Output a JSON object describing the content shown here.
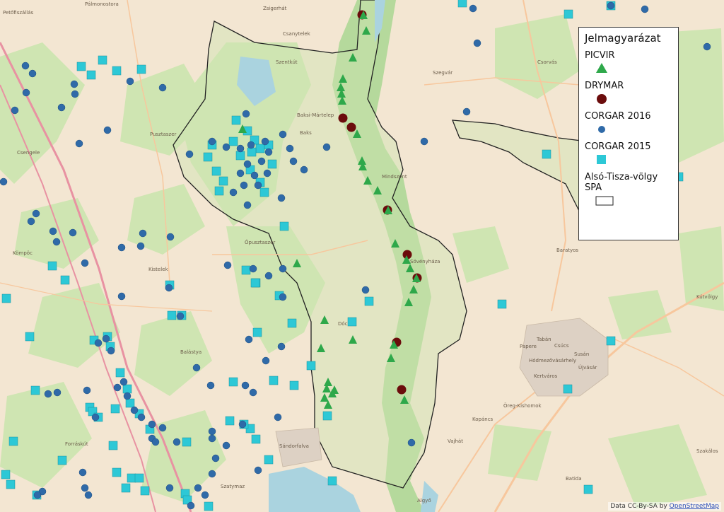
{
  "colors": {
    "background": "#f3e6d2",
    "green_area": "#cfe5b2",
    "dark_green": "#b5d99c",
    "water": "#aad3df",
    "road_major": "#e892a2",
    "road_minor": "#f7c79d",
    "picvir": "#2ea84a",
    "drymar": "#6b0c0c",
    "corgar2016": "#2f6aa8",
    "corgar2015": "#2dc8d6",
    "spa_outline": "#222222"
  },
  "legend": {
    "title": "Jelmagyarázat",
    "items": [
      {
        "label": "PICVIR",
        "symbol": "green-triangle"
      },
      {
        "label": "DRYMAR",
        "symbol": "dark-red-circle"
      },
      {
        "label": "CORGAR 2016",
        "symbol": "blue-circle"
      },
      {
        "label": "CORGAR 2015",
        "symbol": "cyan-square"
      },
      {
        "label": "Alsó-Tisza-völgy SPA",
        "symbol": "outline-rectangle"
      }
    ]
  },
  "place_labels": [
    "Mindszent",
    "Kistelek",
    "Hódmezővásárhely",
    "Sándorfalva",
    "Baksi-Mártelep",
    "Szegvár",
    "Balástya",
    "Ópusztaszer",
    "Baratyos",
    "Csorvás",
    "Kútvölgy",
    "Öreg-Kishomok",
    "Újvásár",
    "Tabán",
    "Susán",
    "Csúcs",
    "Papere",
    "Kertváros",
    "Kopáncs",
    "Szakálos",
    "Batida",
    "Vajhát",
    "Kömpöc",
    "Forráskút",
    "Csengele",
    "Pusztaszer",
    "Dóc",
    "Sövényháza",
    "Zsigerhát",
    "Csanytelek",
    "Szentkút",
    "Pálmonostora",
    "Petőfiszállás",
    "Baks",
    "Algyő",
    "Szatymaz"
  ],
  "attribution": {
    "text": "Data CC-By-SA by ",
    "link": "OpenStreetMap"
  },
  "layers": {
    "picvir": [
      [
        514,
        22
      ],
      [
        518,
        44
      ],
      [
        499,
        82
      ],
      [
        485,
        112
      ],
      [
        482,
        124
      ],
      [
        483,
        133
      ],
      [
        484,
        143
      ],
      [
        512,
        228
      ],
      [
        513,
        236
      ],
      [
        520,
        256
      ],
      [
        534,
        270
      ],
      [
        549,
        298
      ],
      [
        559,
        345
      ],
      [
        575,
        368
      ],
      [
        580,
        380
      ],
      [
        589,
        394
      ],
      [
        585,
        410
      ],
      [
        578,
        428
      ],
      [
        420,
        373
      ],
      [
        459,
        453
      ],
      [
        454,
        493
      ],
      [
        499,
        481
      ],
      [
        557,
        488
      ],
      [
        553,
        507
      ],
      [
        464,
        541
      ],
      [
        462,
        550
      ],
      [
        470,
        557
      ],
      [
        473,
        552
      ],
      [
        459,
        563
      ],
      [
        464,
        573
      ],
      [
        572,
        566
      ],
      [
        505,
        190
      ],
      [
        343,
        183
      ]
    ],
    "drymar": [
      [
        512,
        21
      ],
      [
        485,
        167
      ],
      [
        497,
        180
      ],
      [
        548,
        297
      ],
      [
        576,
        360
      ],
      [
        590,
        393
      ],
      [
        561,
        484
      ],
      [
        568,
        551
      ]
    ],
    "corgar2016": [
      [
        675,
        61
      ],
      [
        1000,
        66
      ],
      [
        864,
        8
      ],
      [
        912,
        13
      ],
      [
        669,
        12
      ],
      [
        36,
        93
      ],
      [
        46,
        104
      ],
      [
        37,
        131
      ],
      [
        21,
        156
      ],
      [
        87,
        152
      ],
      [
        105,
        119
      ],
      [
        106,
        133
      ],
      [
        184,
        115
      ],
      [
        230,
        124
      ],
      [
        348,
        161
      ],
      [
        152,
        184
      ],
      [
        112,
        203
      ],
      [
        268,
        218
      ],
      [
        300,
        200
      ],
      [
        320,
        208
      ],
      [
        340,
        210
      ],
      [
        355,
        205
      ],
      [
        375,
        200
      ],
      [
        380,
        215
      ],
      [
        370,
        228
      ],
      [
        350,
        232
      ],
      [
        340,
        245
      ],
      [
        360,
        248
      ],
      [
        378,
        245
      ],
      [
        365,
        262
      ],
      [
        345,
        262
      ],
      [
        330,
        272
      ],
      [
        350,
        290
      ],
      [
        398,
        280
      ],
      [
        415,
        228
      ],
      [
        462,
        208
      ],
      [
        400,
        190
      ],
      [
        410,
        210
      ],
      [
        430,
        240
      ],
      [
        5,
        257
      ],
      [
        51,
        302
      ],
      [
        44,
        313
      ],
      [
        75,
        327
      ],
      [
        103,
        329
      ],
      [
        202,
        330
      ],
      [
        241,
        335
      ],
      [
        199,
        348
      ],
      [
        80,
        342
      ],
      [
        120,
        372
      ],
      [
        172,
        350
      ],
      [
        239,
        407
      ],
      [
        172,
        419
      ],
      [
        255,
        447
      ],
      [
        322,
        375
      ],
      [
        358,
        380
      ],
      [
        380,
        390
      ],
      [
        400,
        420
      ],
      [
        398,
        490
      ],
      [
        352,
        480
      ],
      [
        376,
        510
      ],
      [
        298,
        545
      ],
      [
        278,
        520
      ],
      [
        347,
        545
      ],
      [
        358,
        555
      ],
      [
        68,
        557
      ],
      [
        81,
        555
      ],
      [
        123,
        552
      ],
      [
        157,
        496
      ],
      [
        150,
        479
      ],
      [
        139,
        485
      ],
      [
        175,
        540
      ],
      [
        166,
        548
      ],
      [
        180,
        560
      ],
      [
        190,
        580
      ],
      [
        200,
        590
      ],
      [
        215,
        600
      ],
      [
        230,
        605
      ],
      [
        250,
        625
      ],
      [
        300,
        610
      ],
      [
        300,
        620
      ],
      [
        320,
        630
      ],
      [
        305,
        648
      ],
      [
        300,
        670
      ],
      [
        280,
        690
      ],
      [
        290,
        700
      ],
      [
        135,
        590
      ],
      [
        215,
        620
      ],
      [
        220,
        625
      ],
      [
        117,
        668
      ],
      [
        120,
        690
      ],
      [
        125,
        700
      ],
      [
        240,
        690
      ],
      [
        270,
        715
      ],
      [
        60,
        695
      ],
      [
        53,
        700
      ],
      [
        517,
        410
      ],
      [
        582,
        626
      ],
      [
        393,
        590
      ],
      [
        343,
        600
      ],
      [
        365,
        665
      ],
      [
        400,
        380
      ],
      [
        600,
        200
      ],
      [
        660,
        158
      ]
    ],
    "corgar2015": [
      [
        145,
        85
      ],
      [
        115,
        94
      ],
      [
        129,
        106
      ],
      [
        165,
        100
      ],
      [
        200,
        98
      ],
      [
        654,
        4
      ],
      [
        804,
        20
      ],
      [
        864,
        8
      ],
      [
        334,
        170
      ],
      [
        350,
        185
      ],
      [
        360,
        198
      ],
      [
        368,
        210
      ],
      [
        380,
        205
      ],
      [
        356,
        215
      ],
      [
        340,
        220
      ],
      [
        300,
        205
      ],
      [
        330,
        200
      ],
      [
        294,
        222
      ],
      [
        306,
        242
      ],
      [
        316,
        256
      ],
      [
        310,
        270
      ],
      [
        354,
        240
      ],
      [
        368,
        258
      ],
      [
        374,
        272
      ],
      [
        385,
        232
      ],
      [
        773,
        218
      ],
      [
        960,
        250
      ],
      [
        710,
        430
      ],
      [
        803,
        550
      ],
      [
        864,
        482
      ],
      [
        832,
        692
      ],
      [
        402,
        320
      ],
      [
        348,
        382
      ],
      [
        362,
        400
      ],
      [
        364,
        470
      ],
      [
        395,
        418
      ],
      [
        413,
        457
      ],
      [
        440,
        517
      ],
      [
        416,
        545
      ],
      [
        387,
        538
      ],
      [
        463,
        588
      ],
      [
        498,
        455
      ],
      [
        522,
        426
      ],
      [
        9,
        422
      ],
      [
        42,
        476
      ],
      [
        74,
        376
      ],
      [
        92,
        396
      ],
      [
        152,
        476
      ],
      [
        133,
        481
      ],
      [
        156,
        490
      ],
      [
        50,
        552
      ],
      [
        127,
        576
      ],
      [
        131,
        582
      ],
      [
        139,
        590
      ],
      [
        180,
        550
      ],
      [
        184,
        570
      ],
      [
        197,
        585
      ],
      [
        212,
        607
      ],
      [
        264,
        625
      ],
      [
        362,
        621
      ],
      [
        354,
        606
      ],
      [
        345,
        600
      ],
      [
        325,
        595
      ],
      [
        243,
        446
      ],
      [
        361,
        400
      ],
      [
        19,
        624
      ],
      [
        88,
        651
      ],
      [
        160,
        630
      ],
      [
        165,
        668
      ],
      [
        178,
        690
      ],
      [
        186,
        676
      ],
      [
        197,
        676
      ],
      [
        205,
        694
      ],
      [
        262,
        698
      ],
      [
        295,
        716
      ],
      [
        265,
        707
      ],
      [
        8,
        671
      ],
      [
        15,
        685
      ],
      [
        52,
        700
      ],
      [
        380,
        650
      ],
      [
        470,
        680
      ],
      [
        240,
        403
      ],
      [
        257,
        446
      ],
      [
        170,
        527
      ],
      [
        163,
        578
      ],
      [
        330,
        540
      ]
    ]
  }
}
